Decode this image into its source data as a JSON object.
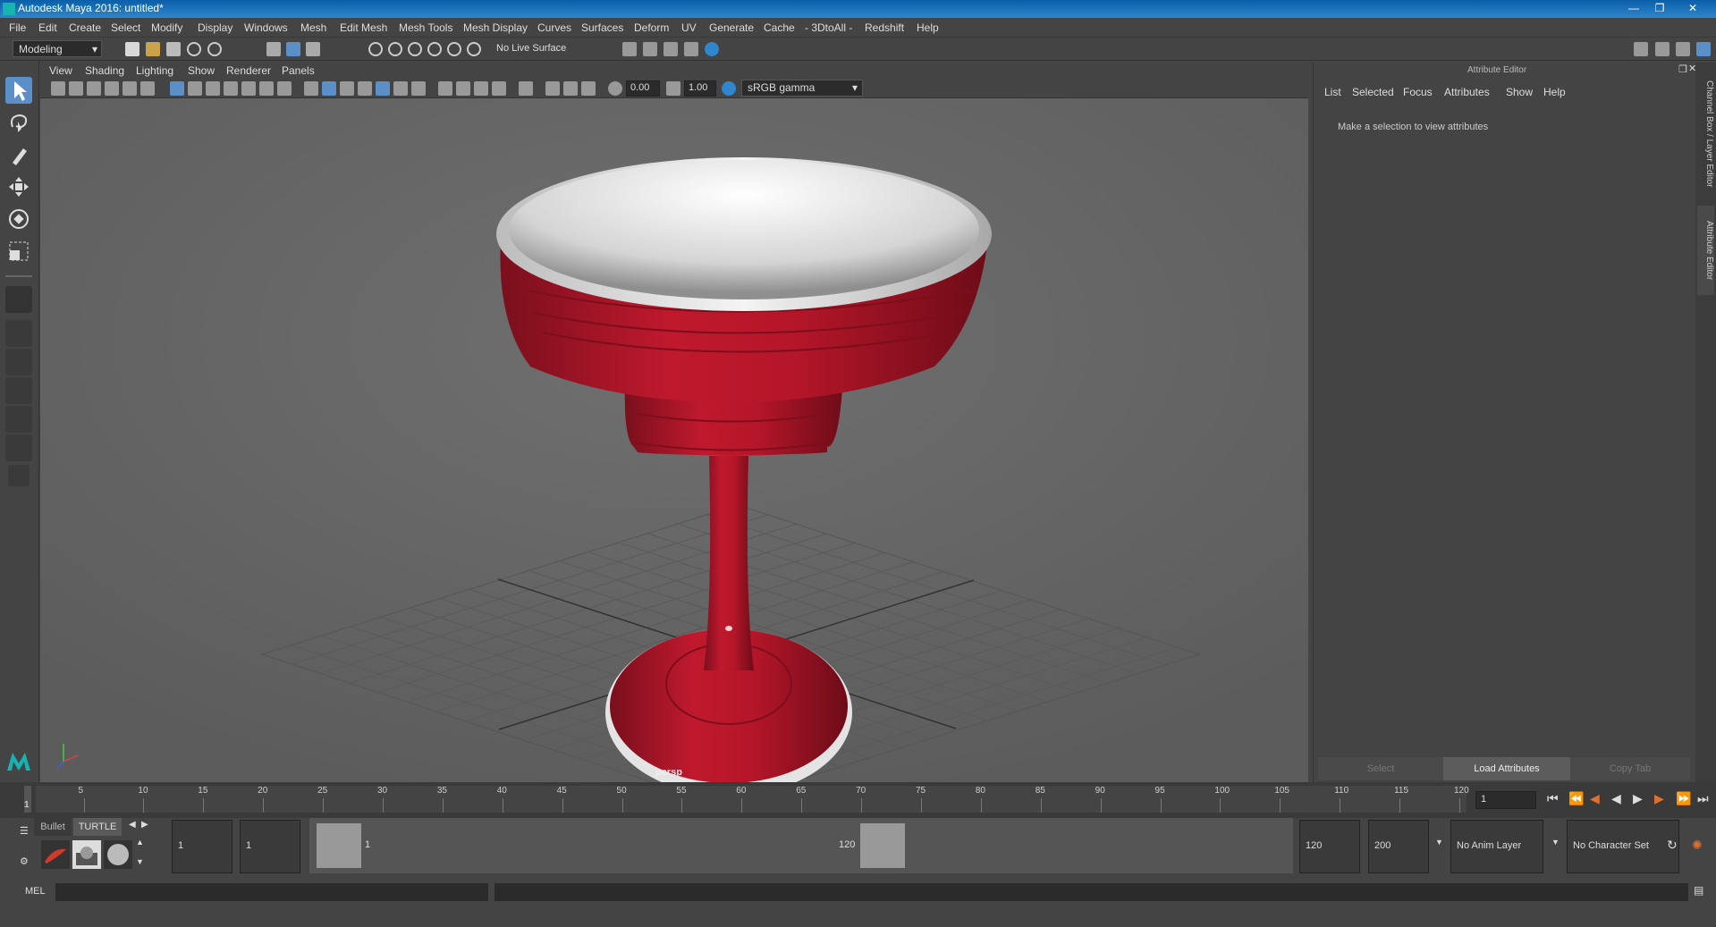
{
  "window": {
    "title": "Autodesk Maya 2016: untitled*"
  },
  "menubar": [
    "File",
    "Edit",
    "Create",
    "Select",
    "Modify",
    "Display",
    "Windows",
    "Mesh",
    "Edit Mesh",
    "Mesh Tools",
    "Mesh Display",
    "Curves",
    "Surfaces",
    "Deform",
    "UV",
    "Generate",
    "Cache",
    "- 3DtoAll -",
    "Redshift",
    "Help"
  ],
  "statusline": {
    "mode": "Modeling",
    "live_surface": "No Live Surface"
  },
  "viewport": {
    "menu": [
      "View",
      "Shading",
      "Lighting",
      "Show",
      "Renderer",
      "Panels"
    ],
    "near_value": "0.00",
    "far_value": "1.00",
    "color_space": "sRGB gamma",
    "camera_label": "persp"
  },
  "attribute_editor": {
    "title": "Attribute Editor",
    "menu": [
      "List",
      "Selected",
      "Focus",
      "Attributes",
      "Show",
      "Help"
    ],
    "message": "Make a selection to view attributes",
    "buttons": {
      "select": "Select",
      "load": "Load Attributes",
      "copy": "Copy Tab"
    }
  },
  "side_tabs": {
    "channel_box": "Channel Box / Layer Editor",
    "attribute_editor": "Attribute Editor"
  },
  "timeline": {
    "ticks": [
      "5",
      "10",
      "15",
      "20",
      "25",
      "30",
      "35",
      "40",
      "45",
      "50",
      "55",
      "60",
      "65",
      "70",
      "75",
      "80",
      "85",
      "90",
      "95",
      "100",
      "105",
      "110",
      "115",
      "120"
    ],
    "start_marker": "1",
    "current_frame": "1"
  },
  "shelf": {
    "tab_bullet": "Bullet",
    "tab_turtle": "TURTLE"
  },
  "range": {
    "start_frame": "1",
    "playback_start": "1",
    "range_start_label": "1",
    "range_end_label": "120",
    "playback_end": "120",
    "end_frame": "200",
    "anim_layer": "No Anim Layer",
    "character_set": "No Character Set"
  },
  "command_line": {
    "label": "MEL"
  },
  "colors": {
    "cup_red": "#b3192c",
    "rim_white": "#e8e8e8",
    "accent_blue": "#2f86cc",
    "viewport_bg": "#6a6a6a"
  }
}
